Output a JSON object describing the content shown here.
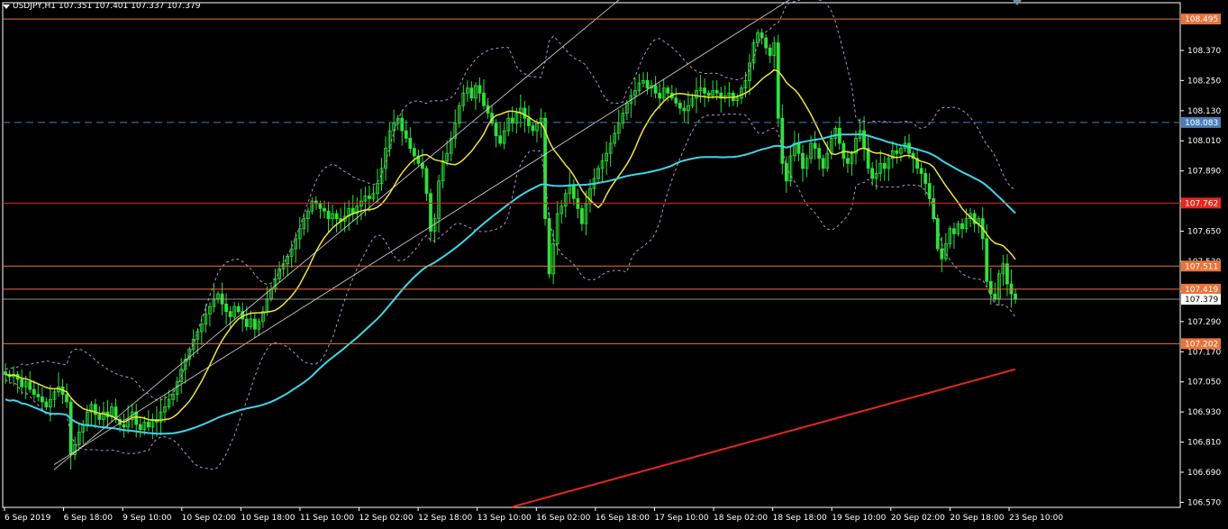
{
  "header": {
    "symbol": "USDJPY,H1",
    "quotes": "107.351 107.401 107.337 107.379"
  },
  "chart_data": {
    "type": "candlestick",
    "ylim": [
      106.55,
      108.56
    ],
    "y_ticks": [
      "108.370",
      "108.250",
      "108.130",
      "108.010",
      "107.890",
      "107.770",
      "107.650",
      "107.530",
      "107.410",
      "107.290",
      "107.170",
      "107.050",
      "106.930",
      "106.810",
      "106.690",
      "106.570"
    ],
    "x_ticks": [
      "6 Sep 2019",
      "6 Sep 18:00",
      "9 Sep 10:00",
      "10 Sep 02:00",
      "10 Sep 18:00",
      "11 Sep 10:00",
      "12 Sep 02:00",
      "12 Sep 18:00",
      "13 Sep 10:00",
      "16 Sep 02:00",
      "16 Sep 18:00",
      "17 Sep 10:00",
      "18 Sep 02:00",
      "18 Sep 18:00",
      "19 Sep 10:00",
      "20 Sep 02:00",
      "20 Sep 18:00",
      "23 Sep 10:00"
    ],
    "price_levels": [
      {
        "value": 108.495,
        "label": "108.495",
        "color": "#e8743b",
        "style": "solid"
      },
      {
        "value": 108.083,
        "label": "108.083",
        "color": "#4a7fb5",
        "style": "dashed"
      },
      {
        "value": 107.762,
        "label": "107.762",
        "color": "#e8261c",
        "style": "solid"
      },
      {
        "value": 107.511,
        "label": "107.511",
        "color": "#e8743b",
        "style": "solid"
      },
      {
        "value": 107.419,
        "label": "107.419",
        "color": "#e8743b",
        "style": "solid"
      },
      {
        "value": 107.202,
        "label": "107.202",
        "color": "#e8743b",
        "style": "solid"
      }
    ],
    "current_price": {
      "value": 107.379,
      "label": "107.379"
    },
    "series_close": [
      107.08,
      107.07,
      107.08,
      107.06,
      107.03,
      107.05,
      107.02,
      107.0,
      106.99,
      106.97,
      106.95,
      106.98,
      107.01,
      107.03,
      107.0,
      106.97,
      106.76,
      106.8,
      106.85,
      106.88,
      106.93,
      106.96,
      106.92,
      106.9,
      106.93,
      106.91,
      106.95,
      106.9,
      106.88,
      106.87,
      106.9,
      106.93,
      106.88,
      106.86,
      106.89,
      106.87,
      106.9,
      106.89,
      106.93,
      106.95,
      106.98,
      107.0,
      107.05,
      107.1,
      107.14,
      107.18,
      107.22,
      107.25,
      107.28,
      107.32,
      107.35,
      107.38,
      107.4,
      107.36,
      107.33,
      107.31,
      107.35,
      107.33,
      107.3,
      107.27,
      107.3,
      107.26,
      107.29,
      107.33,
      107.38,
      107.42,
      107.46,
      107.5,
      107.52,
      107.55,
      107.58,
      107.62,
      107.66,
      107.7,
      107.73,
      107.77,
      107.76,
      107.74,
      107.73,
      107.7,
      107.72,
      107.7,
      107.69,
      107.71,
      107.74,
      107.72,
      107.75,
      107.77,
      107.79,
      107.78,
      107.8,
      107.84,
      107.9,
      107.98,
      108.05,
      108.08,
      108.1,
      108.05,
      108.02,
      107.98,
      107.95,
      107.92,
      107.9,
      107.8,
      107.65,
      107.7,
      107.85,
      107.93,
      107.96,
      108.02,
      108.08,
      108.15,
      108.2,
      108.22,
      108.18,
      108.23,
      108.2,
      108.15,
      108.12,
      108.08,
      108.03,
      108.0,
      108.05,
      108.1,
      108.08,
      108.12,
      108.14,
      108.1,
      108.07,
      108.05,
      108.08,
      108.1,
      107.7,
      107.48,
      107.6,
      107.72,
      107.75,
      107.8,
      107.83,
      107.78,
      107.74,
      107.68,
      107.76,
      107.82,
      107.86,
      107.9,
      107.93,
      107.96,
      108.0,
      108.04,
      108.08,
      108.12,
      108.16,
      108.19,
      108.21,
      108.24,
      108.25,
      108.22,
      108.23,
      108.2,
      108.18,
      108.22,
      108.2,
      108.18,
      108.16,
      108.14,
      108.13,
      108.15,
      108.18,
      108.21,
      108.22,
      108.2,
      108.19,
      108.21,
      108.2,
      108.18,
      108.19,
      108.2,
      108.17,
      108.18,
      108.22,
      108.25,
      108.32,
      108.4,
      108.44,
      108.42,
      108.38,
      108.35,
      108.4,
      108.1,
      107.92,
      107.85,
      107.95,
      108.0,
      107.96,
      107.9,
      107.94,
      108.0,
      107.98,
      107.94,
      107.9,
      107.96,
      108.02,
      108.06,
      108.0,
      107.94,
      107.92,
      107.96,
      108.02,
      108.05,
      107.98,
      107.9,
      107.86,
      107.88,
      107.92,
      107.9,
      107.94,
      107.97,
      107.96,
      107.98,
      108.0,
      107.96,
      107.94,
      107.9,
      107.88,
      107.84,
      107.78,
      107.7,
      107.58,
      107.54,
      107.6,
      107.66,
      107.64,
      107.68,
      107.66,
      107.7,
      107.72,
      107.68,
      107.7,
      107.62,
      107.45,
      107.4,
      107.38,
      107.48,
      107.52,
      107.44,
      107.4,
      107.38
    ],
    "indicators": [
      {
        "name": "ma_yellow",
        "color": "#f2e43a"
      },
      {
        "name": "ma_cyan",
        "color": "#3fd4ea"
      },
      {
        "name": "ma_red",
        "color": "#e8261c"
      },
      {
        "name": "bollinger",
        "color": "#b98fcf"
      },
      {
        "name": "trendlines",
        "color": "#d8d8d8"
      }
    ],
    "colors": {
      "background": "#000000",
      "candle": "#2ee03a",
      "axis": "#ffffff",
      "text": "#ffffff"
    }
  }
}
